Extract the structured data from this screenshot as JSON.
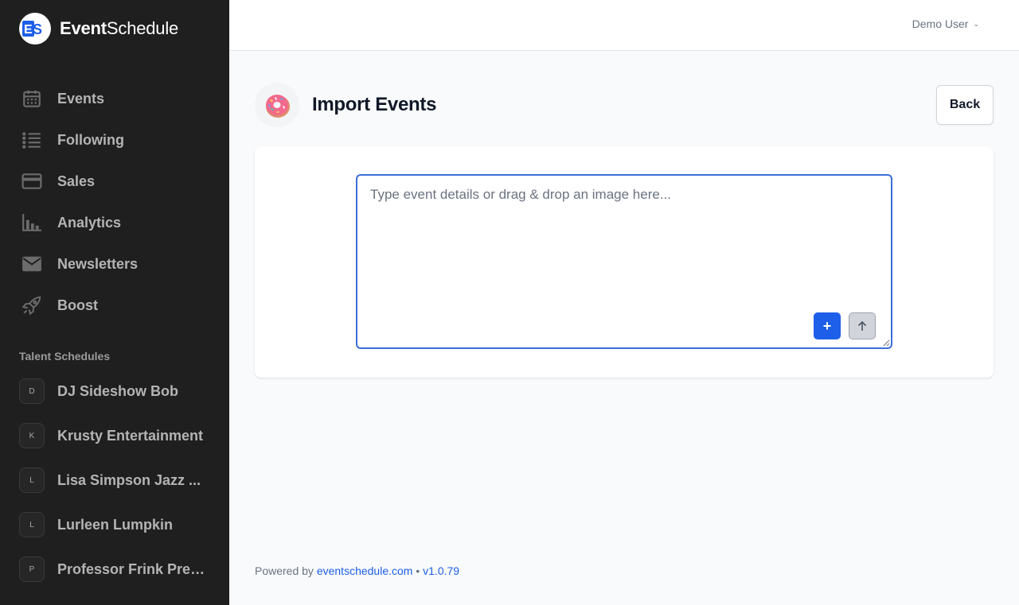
{
  "brand": {
    "name_bold": "Event",
    "name_light": "Schedule",
    "logo_text": "ES"
  },
  "nav": {
    "items": [
      {
        "label": "Events",
        "icon": "calendar-icon"
      },
      {
        "label": "Following",
        "icon": "list-icon"
      },
      {
        "label": "Sales",
        "icon": "credit-card-icon"
      },
      {
        "label": "Analytics",
        "icon": "bar-chart-icon"
      },
      {
        "label": "Newsletters",
        "icon": "mail-icon"
      },
      {
        "label": "Boost",
        "icon": "rocket-icon"
      }
    ]
  },
  "talent": {
    "title": "Talent Schedules",
    "items": [
      {
        "initial": "D",
        "label": "DJ Sideshow Bob"
      },
      {
        "initial": "K",
        "label": "Krusty Entertainment"
      },
      {
        "initial": "L",
        "label": "Lisa Simpson Jazz ..."
      },
      {
        "initial": "L",
        "label": "Lurleen Lumpkin"
      },
      {
        "initial": "P",
        "label": "Professor Frink Pres..."
      }
    ]
  },
  "header": {
    "user": "Demo User"
  },
  "page": {
    "title": "Import Events",
    "back_label": "Back",
    "import_placeholder": "Type event details or drag & drop an image here...",
    "add_label": "+"
  },
  "footer": {
    "prefix": "Powered by",
    "link": "eventschedule.com",
    "separator": "•",
    "version": "v1.0.79"
  },
  "colors": {
    "sidebar_bg": "#1f1f1f",
    "accent": "#1d5fe8",
    "page_bg": "#f9fafb"
  }
}
